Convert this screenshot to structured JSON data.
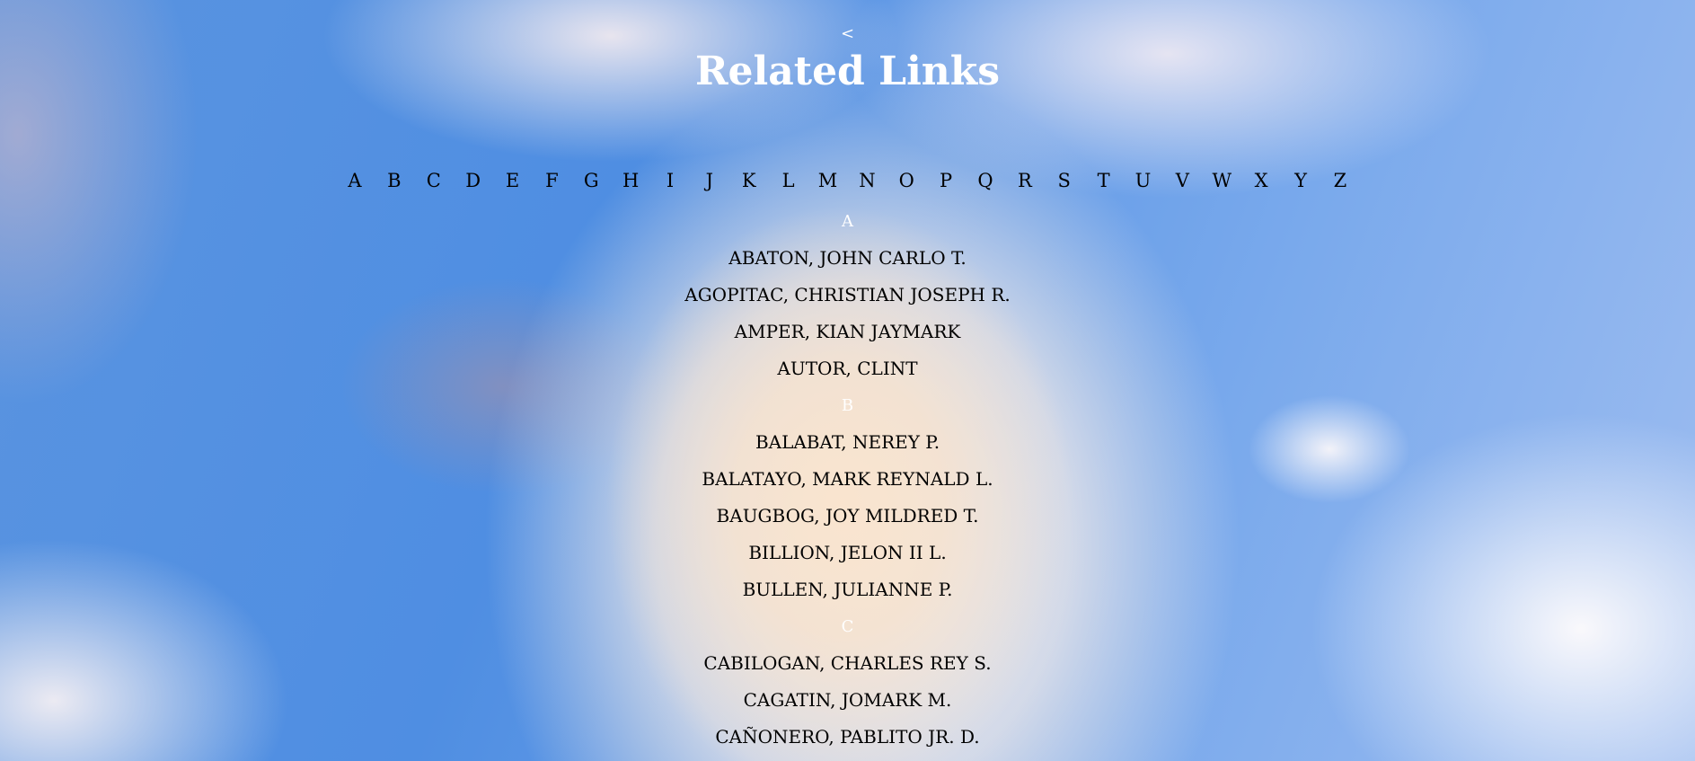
{
  "header": {
    "back_label": "<",
    "title": "Related Links"
  },
  "alphabet": [
    "A",
    "B",
    "C",
    "D",
    "E",
    "F",
    "G",
    "H",
    "I",
    "J",
    "K",
    "L",
    "M",
    "N",
    "O",
    "P",
    "Q",
    "R",
    "S",
    "T",
    "U",
    "V",
    "W",
    "X",
    "Y",
    "Z"
  ],
  "sections": [
    {
      "letter": "A",
      "names": [
        "ABATON, JOHN CARLO T.",
        "AGOPITAC, CHRISTIAN JOSEPH R.",
        "AMPER, KIAN JAYMARK",
        "AUTOR, CLINT"
      ]
    },
    {
      "letter": "B",
      "names": [
        "BALABAT, NEREY P.",
        "BALATAYO, MARK REYNALD L.",
        "BAUGBOG, JOY MILDRED T.",
        "BILLION, JELON II L.",
        "BULLEN, JULIANNE P."
      ]
    },
    {
      "letter": "C",
      "names": [
        "CABILOGAN, CHARLES REY S.",
        "CAGATIN, JOMARK M.",
        "CAÑONERO, PABLITO JR. D."
      ]
    }
  ],
  "colors": {
    "heading_text": "#ffffff",
    "link_text": "#000000",
    "sky_blue": "#4f8ee2"
  }
}
